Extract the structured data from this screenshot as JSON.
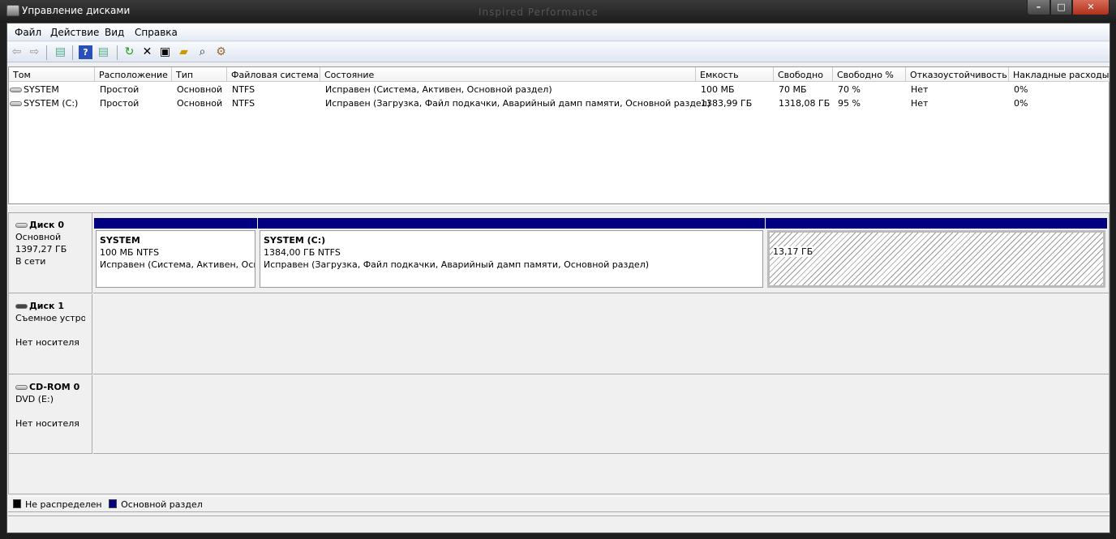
{
  "window": {
    "title": "Управление дисками",
    "theme_watermark": "Inspired Performance",
    "controls": {
      "minimize": "–",
      "maximize": "□",
      "close": "✕"
    }
  },
  "menu": [
    "Файл",
    "Действие",
    "Вид",
    "Справка"
  ],
  "toolbar": [
    "back-icon",
    "forward-icon",
    "console-tree-icon",
    "help-icon",
    "action-pane-icon",
    "refresh-icon",
    "delete-icon",
    "properties-icon",
    "open-icon",
    "search-icon",
    "settings-icon"
  ],
  "volume_table": {
    "columns": [
      "Том",
      "Расположение",
      "Тип",
      "Файловая система",
      "Состояние",
      "Емкость",
      "Свободно",
      "Свободно %",
      "Отказоустойчивость",
      "Накладные расходы"
    ],
    "rows": [
      [
        "SYSTEM",
        "Простой",
        "Основной",
        "NTFS",
        "Исправен (Система, Активен, Основной раздел)",
        "100 МБ",
        "70 МБ",
        "70 %",
        "Нет",
        "0%"
      ],
      [
        "SYSTEM (C:)",
        "Простой",
        "Основной",
        "NTFS",
        "Исправен (Загрузка, Файл подкачки, Аварийный дамп памяти, Основной раздел)",
        "1383,99 ГБ",
        "1318,08 ГБ",
        "95 %",
        "Нет",
        "0%"
      ]
    ]
  },
  "disks": [
    {
      "name": "Диск 0",
      "type": "Основной",
      "size": "1397,27 ГБ",
      "status": "В сети",
      "partitions": [
        {
          "name": "SYSTEM",
          "size": "100 МБ NTFS",
          "status": "Исправен (Система, Активен, Осн"
        },
        {
          "name": "SYSTEM  (C:)",
          "size": "1384,00 ГБ NTFS",
          "status": "Исправен (Загрузка, Файл подкачки, Аварийный дамп памяти, Основной раздел)"
        },
        {
          "size": "13,17 ГБ"
        }
      ]
    },
    {
      "name": "Диск 1",
      "type": "Съемное устрoi",
      "status": "Нет носителя"
    },
    {
      "name": "CD-ROM 0",
      "type": "DVD (E:)",
      "status": "Нет носителя"
    }
  ],
  "legend": [
    {
      "label": "Не распределен",
      "color": "#000000"
    },
    {
      "label": "Основной раздел",
      "color": "#000080"
    }
  ]
}
